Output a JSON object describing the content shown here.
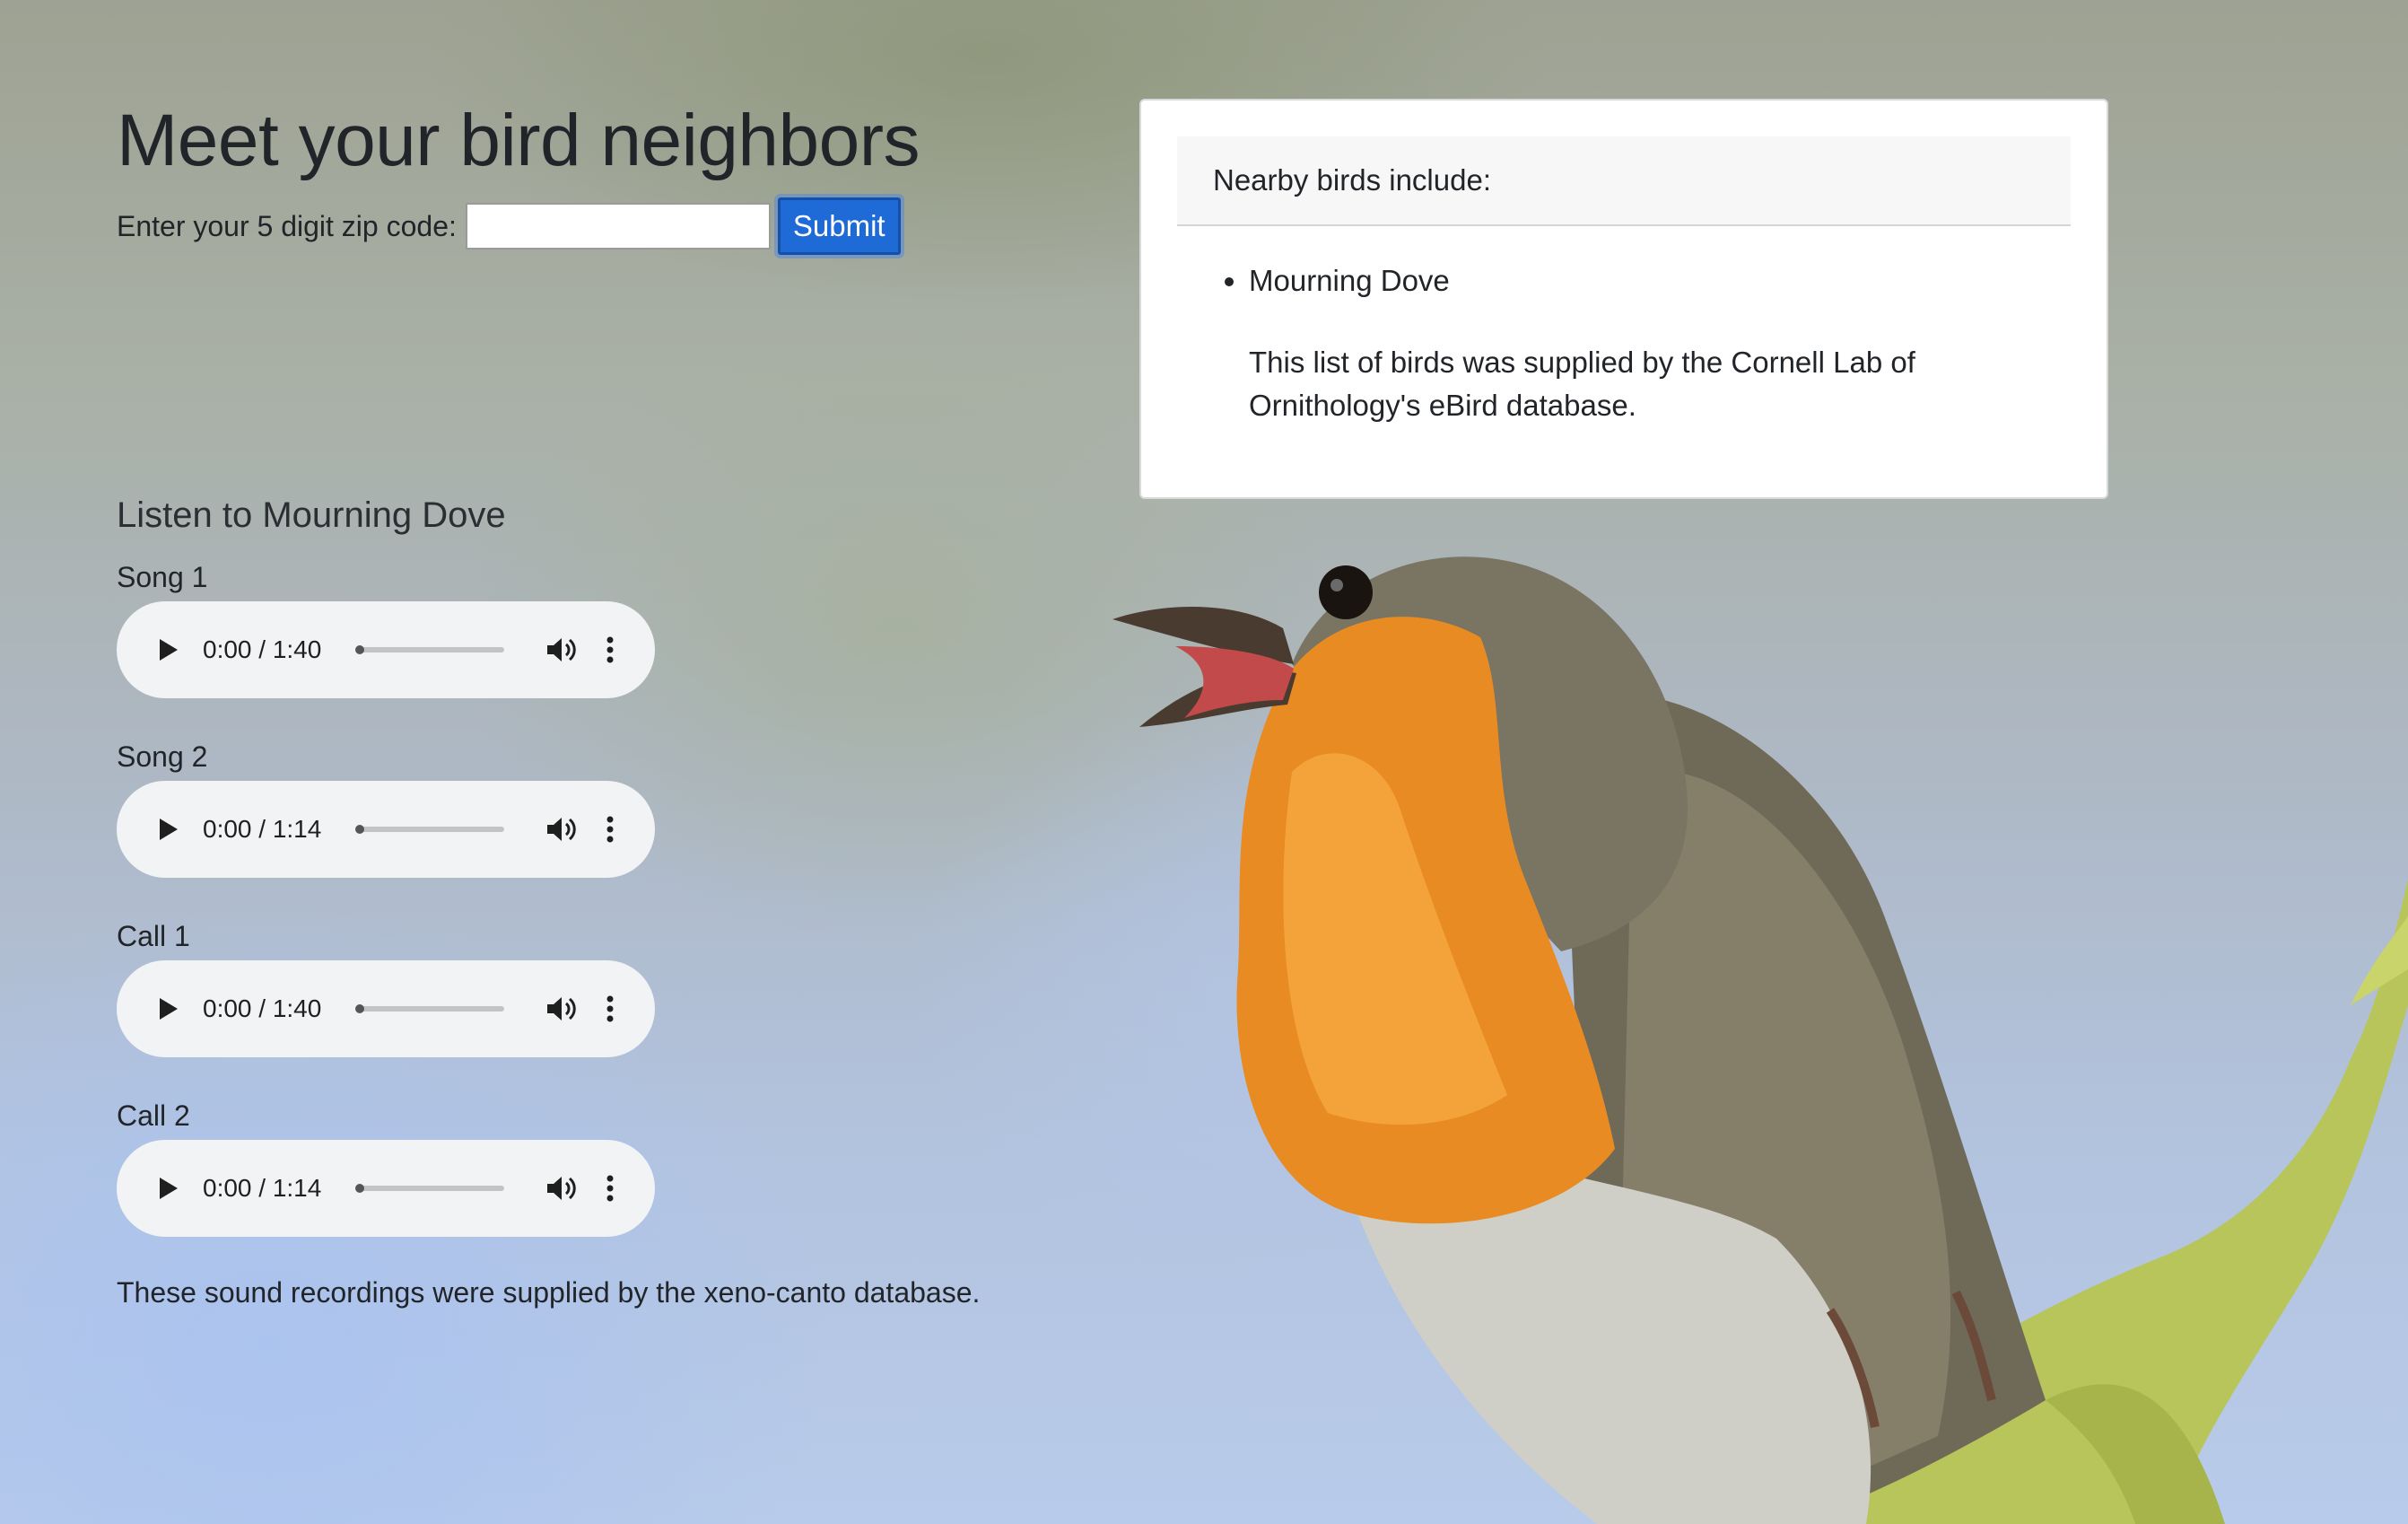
{
  "header": {
    "title": "Meet your bird neighbors"
  },
  "zip_form": {
    "label": "Enter your 5 digit zip code:",
    "input_value": "",
    "submit_label": "Submit"
  },
  "listen": {
    "heading": "Listen to Mourning Dove",
    "recordings": [
      {
        "label": "Song 1",
        "time": "0:00 / 1:40"
      },
      {
        "label": "Song 2",
        "time": "0:00 / 1:14"
      },
      {
        "label": "Call 1",
        "time": "0:00 / 1:40"
      },
      {
        "label": "Call 2",
        "time": "0:00 / 1:14"
      }
    ],
    "credit": "These sound recordings were supplied by the xeno-canto database."
  },
  "nearby_card": {
    "header": "Nearby birds include:",
    "birds": [
      "Mourning Dove"
    ],
    "credit": "This list of birds was supplied by the Cornell Lab of Ornithology's eBird database."
  },
  "icons": {
    "play": "play-icon",
    "volume": "volume-icon",
    "menu": "more-vert-icon"
  },
  "colors": {
    "submit_bg": "#1e6ad6",
    "player_bg": "#f1f3f4",
    "card_bg": "#ffffff"
  }
}
